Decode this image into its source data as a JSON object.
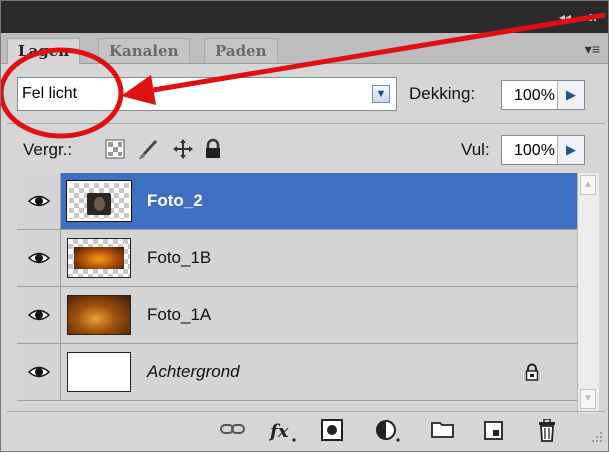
{
  "tabs": [
    {
      "label": "Lagen",
      "active": true
    },
    {
      "label": "Kanalen",
      "active": false
    },
    {
      "label": "Paden",
      "active": false
    }
  ],
  "panel_controls": {
    "collapse": "◂◂",
    "close": "x",
    "menu": "▾≡"
  },
  "blend_mode": {
    "value": "Fel licht"
  },
  "opacity": {
    "label": "Dekking:",
    "value": "100%"
  },
  "lock": {
    "label": "Vergr.:"
  },
  "fill": {
    "label": "Vul:",
    "value": "100%"
  },
  "layers": [
    {
      "name": "Foto_2",
      "selected": true,
      "visible": true,
      "italic": false,
      "locked": false
    },
    {
      "name": "Foto_1B",
      "selected": false,
      "visible": true,
      "italic": false,
      "locked": false
    },
    {
      "name": "Foto_1A",
      "selected": false,
      "visible": true,
      "italic": false,
      "locked": false
    },
    {
      "name": "Achtergrond",
      "selected": false,
      "visible": true,
      "italic": true,
      "locked": true
    }
  ],
  "bottom_icons": [
    "link-icon",
    "fx-icon",
    "layer-mask-icon",
    "adjustment-layer-icon",
    "group-folder-icon",
    "new-layer-icon",
    "trash-icon"
  ],
  "colors": {
    "selection": "#3f6fc2",
    "annotation": "#e01010"
  }
}
